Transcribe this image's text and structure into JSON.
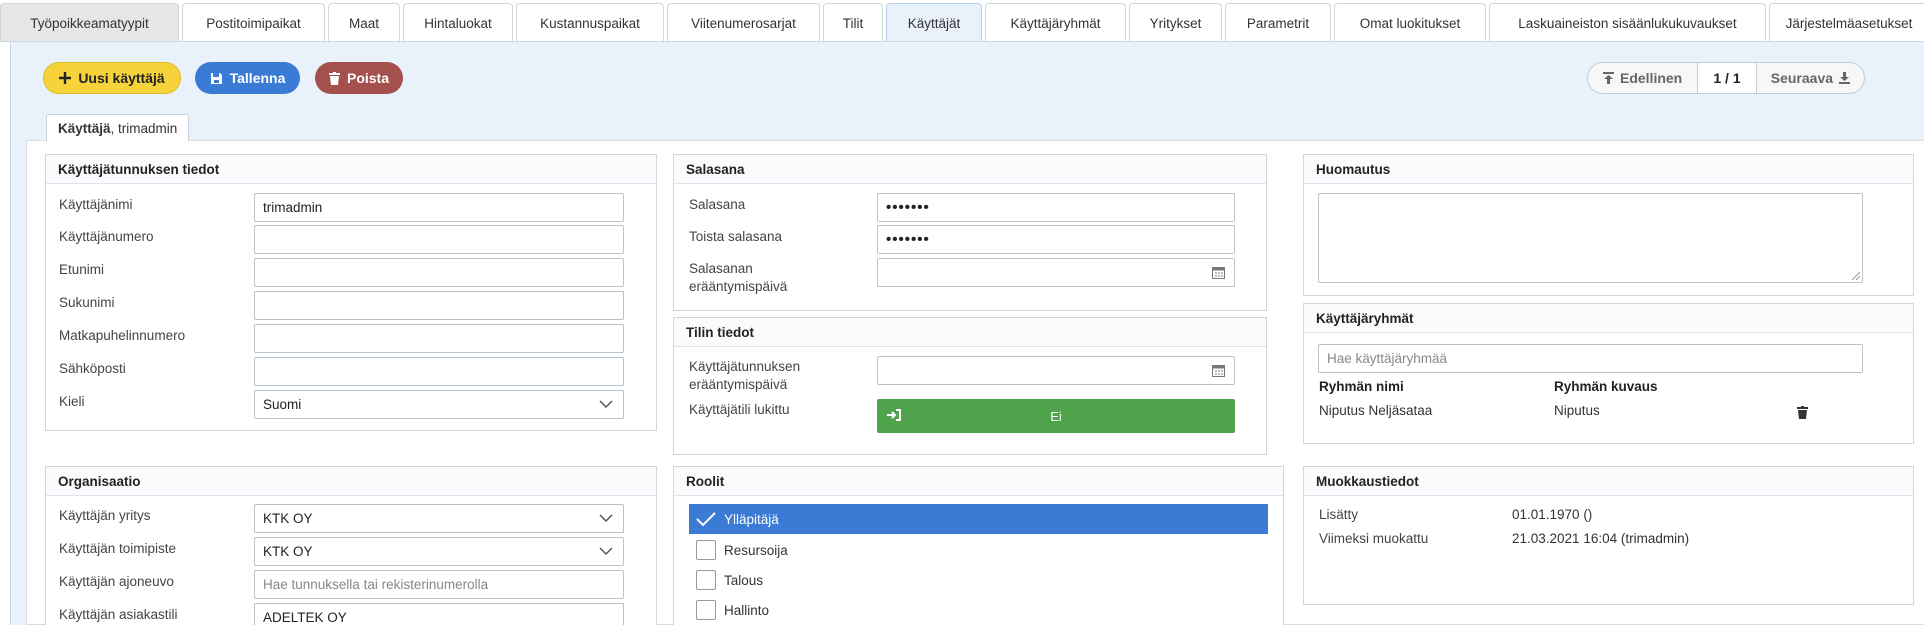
{
  "tabs": [
    {
      "label": "Työpoikkeamatyypit"
    },
    {
      "label": "Postitoimipaikat"
    },
    {
      "label": "Maat"
    },
    {
      "label": "Hintaluokat"
    },
    {
      "label": "Kustannuspaikat"
    },
    {
      "label": "Viitenumerosarjat"
    },
    {
      "label": "Tilit"
    },
    {
      "label": "Käyttäjät"
    },
    {
      "label": "Käyttäjäryhmät"
    },
    {
      "label": "Yritykset"
    },
    {
      "label": "Parametrit"
    },
    {
      "label": "Omat luokitukset"
    },
    {
      "label": "Laskuaineiston sisäänlukukuvaukset"
    },
    {
      "label": "Järjestelmäasetukset"
    }
  ],
  "toolbar": {
    "new_label": "Uusi käyttäjä",
    "save_label": "Tallenna",
    "delete_label": "Poista"
  },
  "pager": {
    "prev_label": "Edellinen",
    "count": "1 / 1",
    "next_label": "Seuraava"
  },
  "record_tab": {
    "entity": "Käyttäjä",
    "name": ", trimadmin"
  },
  "account_info": {
    "title": "Käyttäjätunnuksen tiedot",
    "username_label": "Käyttäjänimi",
    "username_value": "trimadmin",
    "usernumber_label": "Käyttäjänumero",
    "firstname_label": "Etunimi",
    "lastname_label": "Sukunimi",
    "mobile_label": "Matkapuhelinnumero",
    "email_label": "Sähköposti",
    "language_label": "Kieli",
    "language_value": "Suomi"
  },
  "password": {
    "title": "Salasana",
    "password_label": "Salasana",
    "password_value": "•••••••",
    "repeat_label": "Toista salasana",
    "repeat_value": "•••••••",
    "expiry_label_1": "Salasanan",
    "expiry_label_2": "erääntymispäivä"
  },
  "account": {
    "title": "Tilin tiedot",
    "expiry_label_1": "Käyttäjätunnuksen",
    "expiry_label_2": "erääntymispäivä",
    "locked_label": "Käyttäjätili lukittu",
    "locked_value": "Ei"
  },
  "note": {
    "title": "Huomautus"
  },
  "user_groups": {
    "title": "Käyttäjäryhmät",
    "search_placeholder": "Hae käyttäjäryhmää",
    "col_name": "Ryhmän nimi",
    "col_desc": "Ryhmän kuvaus",
    "rows": [
      {
        "name": "Niputus Neljäsataa",
        "desc": "Niputus"
      }
    ]
  },
  "organization": {
    "title": "Organisaatio",
    "company_label": "Käyttäjän yritys",
    "company_value": "KTK OY",
    "office_label": "Käyttäjän toimipiste",
    "office_value": "KTK OY",
    "vehicle_label": "Käyttäjän ajoneuvo",
    "vehicle_placeholder": "Hae tunnuksella tai rekisterinumerolla",
    "customer_label": "Käyttäjän asiakastili",
    "customer_value": "ADELTEK OY"
  },
  "roles": {
    "title": "Roolit",
    "items": [
      {
        "label": "Ylläpitäjä",
        "checked": true
      },
      {
        "label": "Resursoija",
        "checked": false
      },
      {
        "label": "Talous",
        "checked": false
      },
      {
        "label": "Hallinto",
        "checked": false
      }
    ]
  },
  "modified": {
    "title": "Muokkaustiedot",
    "added_label": "Lisätty",
    "added_value": "01.01.1970 ()",
    "modified_label": "Viimeksi muokattu",
    "modified_value": "21.03.2021 16:04 (trimadmin)"
  },
  "colors": {
    "accent": "#3a7bd5",
    "yellow": "#f6d33b",
    "danger": "#a4514d",
    "success": "#4fa34a",
    "panel_bg": "#e9f1fb"
  }
}
